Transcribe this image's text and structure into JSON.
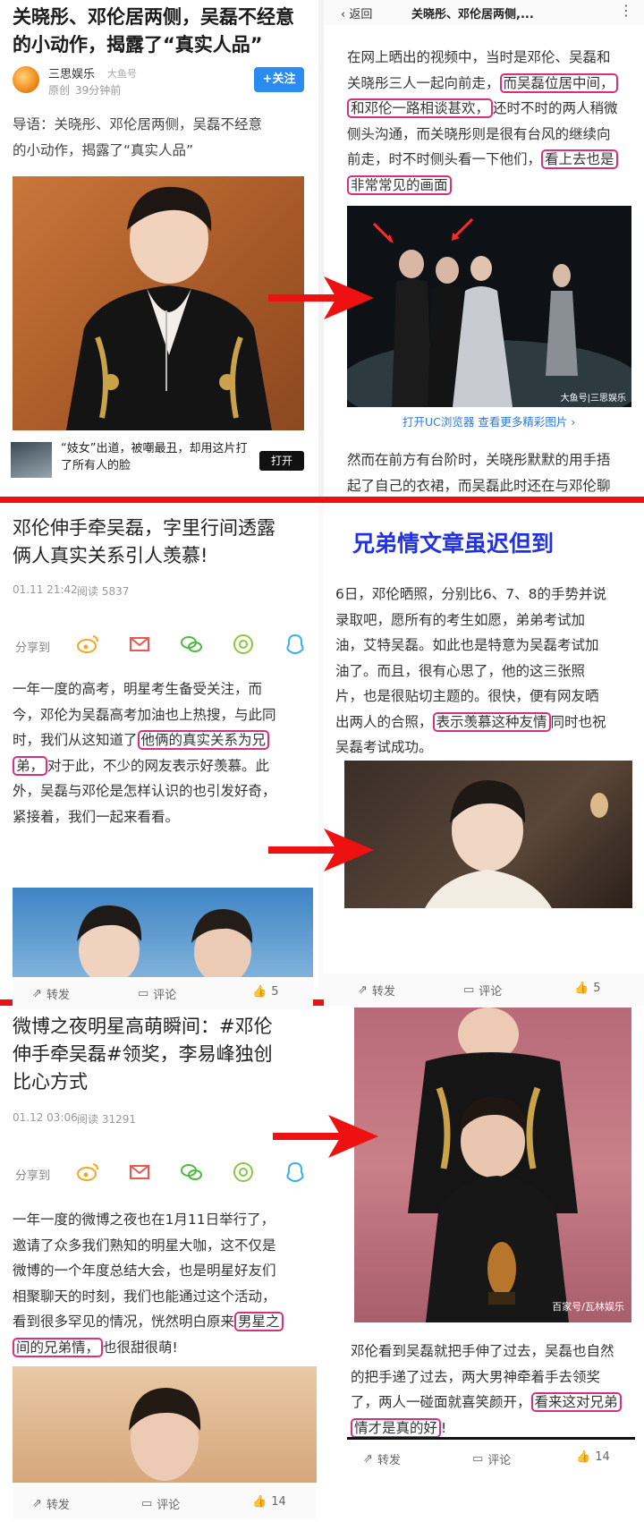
{
  "panel1": {
    "title_line1": "关晓彤、邓伦居两侧，吴磊不经意",
    "title_line2": "的小动作，揭露了“真实人品”",
    "author": "三思娱乐",
    "platform_tag": "大鱼号",
    "original_tag": "原创",
    "time": "39分钟前",
    "follow": "+关注",
    "intro_line1": "导语：关晓彤、邓伦居两侧，吴磊不经意",
    "intro_line2": "的小动作，揭露了“真实人品”",
    "ad_line1": "“妓女”出道，被嘲最丑，却用这片打",
    "ad_line2": "了所有人的脸",
    "ad_button": "打开"
  },
  "panel2": {
    "back": "返回",
    "nav_title": "关晓彤、邓伦居两侧,...",
    "more": "⋮",
    "p_line1": "在网上晒出的视频中，当时是邓伦、吴磊和",
    "p_line2a": "关晓彤三人一起向前走，",
    "p_line2b": "而吴磊位居中间，",
    "p_line3a": "和邓伦一路相谈甚欢，",
    "p_line3b": "还时不时的两人稍微",
    "p_line4": "侧头沟通，而关晓彤则是很有台风的继续向",
    "p_line5a": "前走，时不时侧头看一下他们，",
    "p_line5b": "看上去也是",
    "p_line6": "非常常见的画面",
    "watermark": "大鱼号|三思娱乐",
    "uc_link": "打开UC浏览器 查看更多精彩图片 ›",
    "next_line1": "然而在前方有台阶时，关晓彤默默的用手捂",
    "next_line2": "起了自己的衣裙，而吴磊此时还在与邓伦聊"
  },
  "panel3": {
    "title_line1": "邓伦伸手牵吴磊，字里行间透露",
    "title_line2": "俩人真实关系引人羡慕!",
    "date": "01.11 21:42",
    "reads": "阅读 5837",
    "share_label": "分享到",
    "b_line1": "一年一度的高考，明星考生备受关注，而",
    "b_line2": "今，邓伦为吴磊高考加油也上热搜，与此同",
    "b_line3a": "时，我们从这知道了",
    "b_line3b": "他俩的真实关系为兄",
    "b_line4a": "弟，",
    "b_line4b": "对于此，不少的网友表示好羡慕。此",
    "b_line5": "外，吴磊与邓伦是怎样认识的也引发好奇，",
    "b_line6": "紧接着，我们一起来看看。",
    "repost": "转发",
    "comment": "评论",
    "likes": "5"
  },
  "panel4": {
    "caption": "兄弟情文章虽迟但到",
    "b_line1": "6日，邓伦晒照，分别比6、7、8的手势并说",
    "b_line2": "录取吧，愿所有的考生如愿，弟弟考试加",
    "b_line3": "油，艾特吴磊。如此也是特意为吴磊考试加",
    "b_line4": "油了。而且，很有心思了，他的这三张照",
    "b_line5": "片，也是很贴切主题的。很快，便有网友晒",
    "b_line6a": "出两人的合照，",
    "b_line6b": "表示羡慕这种友情",
    "b_line6c": "同时也祝",
    "b_line7": "吴磊考试成功。",
    "repost": "转发",
    "comment": "评论",
    "likes": "5"
  },
  "panel5": {
    "title_line1": "微博之夜明星高萌瞬间：#邓伦",
    "title_line2": "伸手牵吴磊#领奖，李易峰独创",
    "title_line3": "比心方式",
    "date": "01.12 03:06",
    "reads": "阅读 31291",
    "share_label": "分享到",
    "b_line1": "一年一度的微博之夜也在1月11日举行了，",
    "b_line2": "邀请了众多我们熟知的明星大咖，这不仅是",
    "b_line3": "微博的一个年度总结大会，也是明星好友们",
    "b_line4": "相聚聊天的时刻，我们也能通过这个活动，",
    "b_line5a": "看到很多罕见的情况，恍然明白原来",
    "b_line5b": "男星之",
    "b_line6a": "间的兄弟情，",
    "b_line6b": "也很甜很萌!",
    "repost": "转发",
    "comment": "评论",
    "likes": "14"
  },
  "panel6": {
    "watermark": "百家号/瓦林娱乐",
    "b_line1": "邓伦看到吴磊就把手伸了过去，吴磊也自然",
    "b_line2": "的把手递了过去，两大男神牵着手去领奖",
    "b_line3a": "了，两人一碰面就喜笑颜开，",
    "b_line3b": "看来这对兄弟",
    "b_line4a": "情才是真的好",
    "b_line4b": "!",
    "repost": "转发",
    "comment": "评论",
    "likes": "14"
  },
  "colors": {
    "divider": "#ee1111",
    "highlight": "#d6317a",
    "follow": "#2a8cf0",
    "link": "#2a7ae2",
    "caption": "#2233dd"
  }
}
